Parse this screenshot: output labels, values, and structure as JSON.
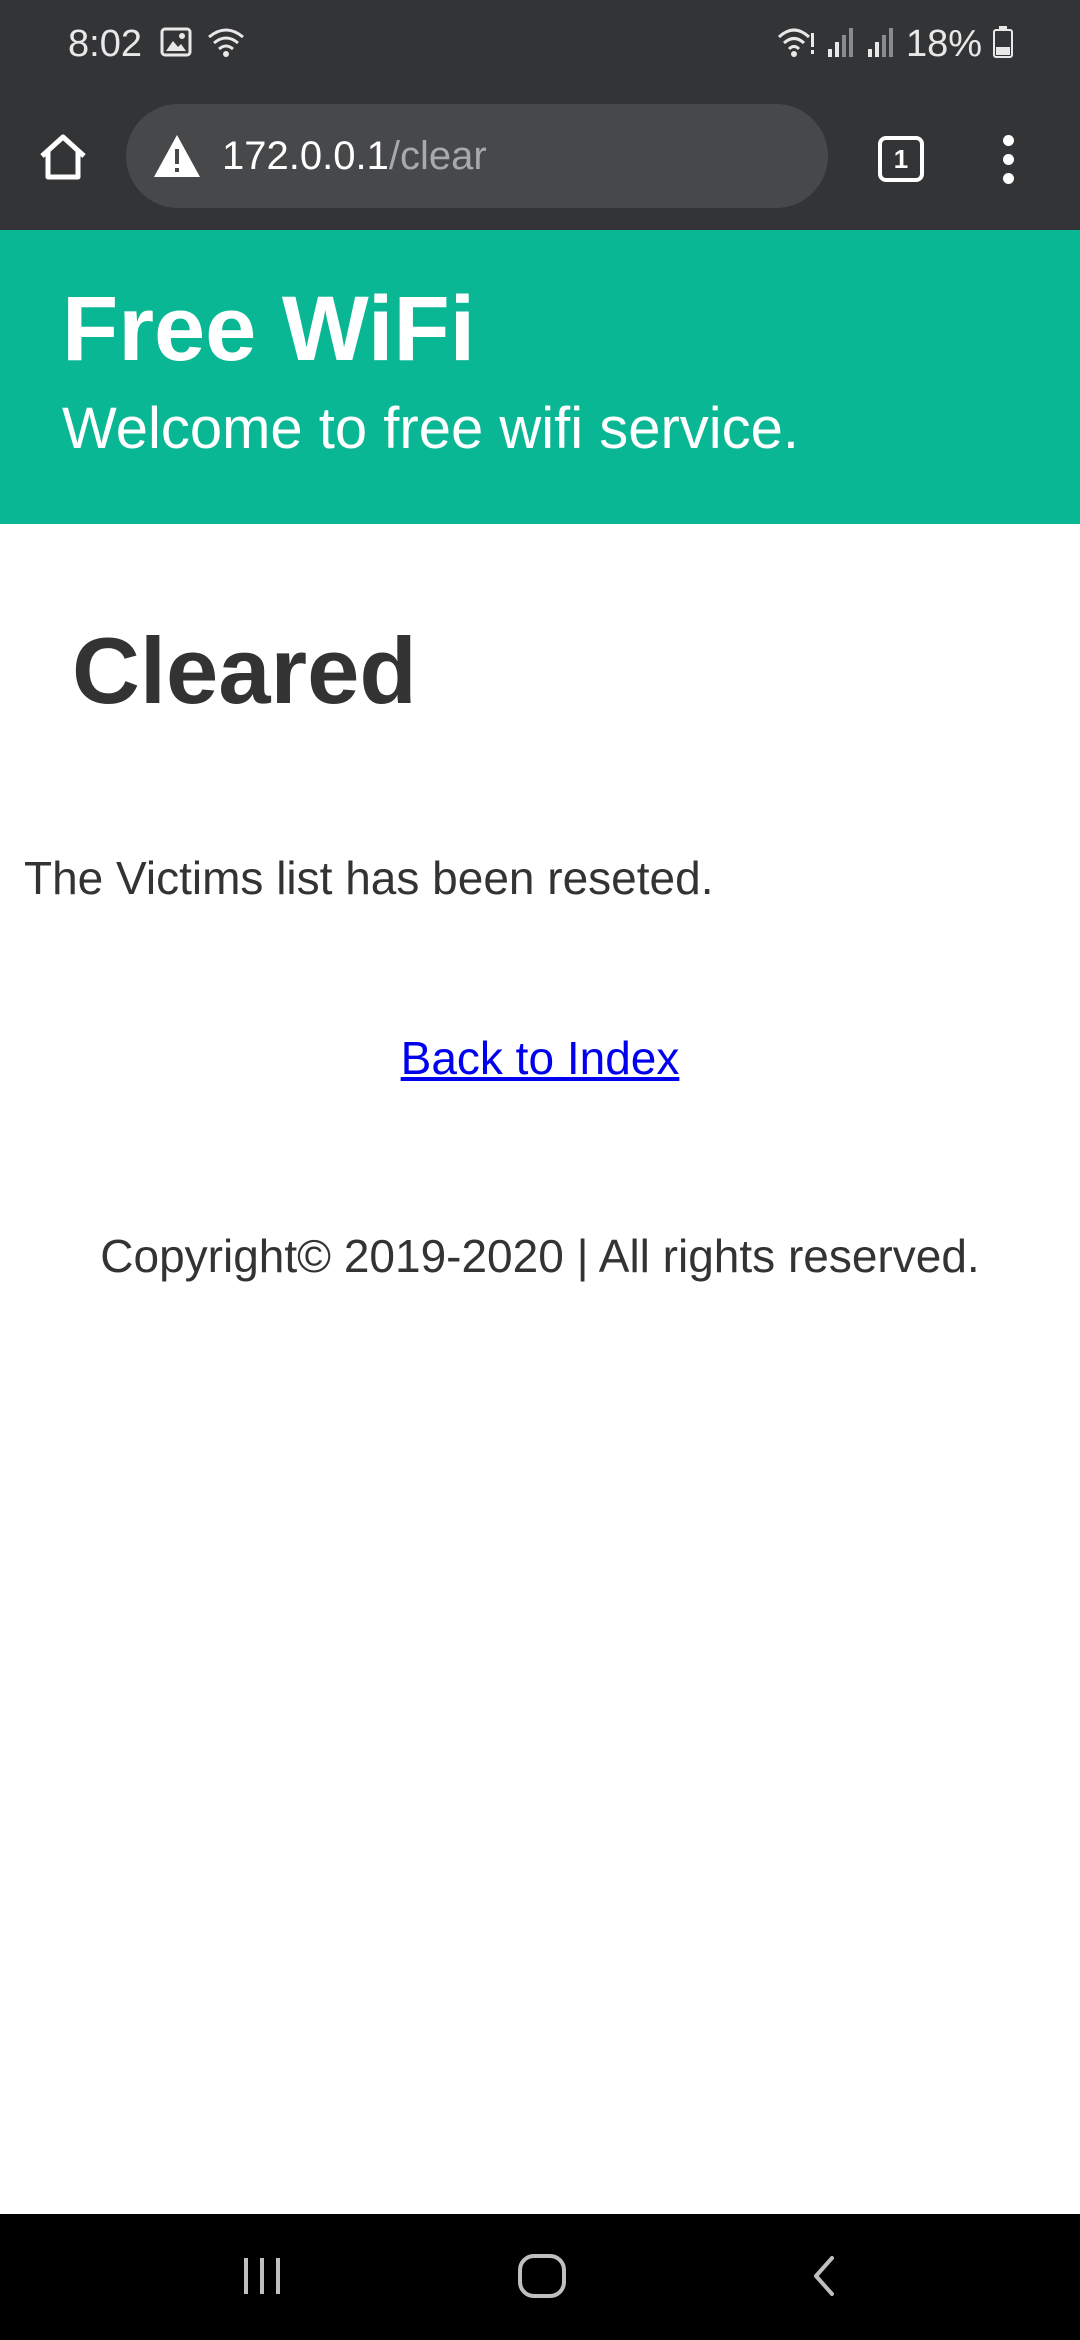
{
  "status_bar": {
    "time": "8:02",
    "battery": "18%",
    "icons_left": [
      "gallery-icon",
      "wifi-question-icon"
    ],
    "icons_right": [
      "wifi-icon",
      "signal-icon",
      "signal-icon",
      "battery-icon"
    ]
  },
  "browser": {
    "url_host": "172.0.0.1",
    "url_path": "/clear",
    "tab_count": "1"
  },
  "page": {
    "header_title": "Free WiFi",
    "header_subtitle": "Welcome to free wifi service.",
    "heading": "Cleared",
    "message": "The Victims list has been reseted.",
    "back_link": "Back to Index",
    "copyright": "Copyright© 2019-2020 | All rights reserved."
  },
  "colors": {
    "header_bg": "#0ab794",
    "chrome_bg": "#333436",
    "link": "#0000ee"
  }
}
